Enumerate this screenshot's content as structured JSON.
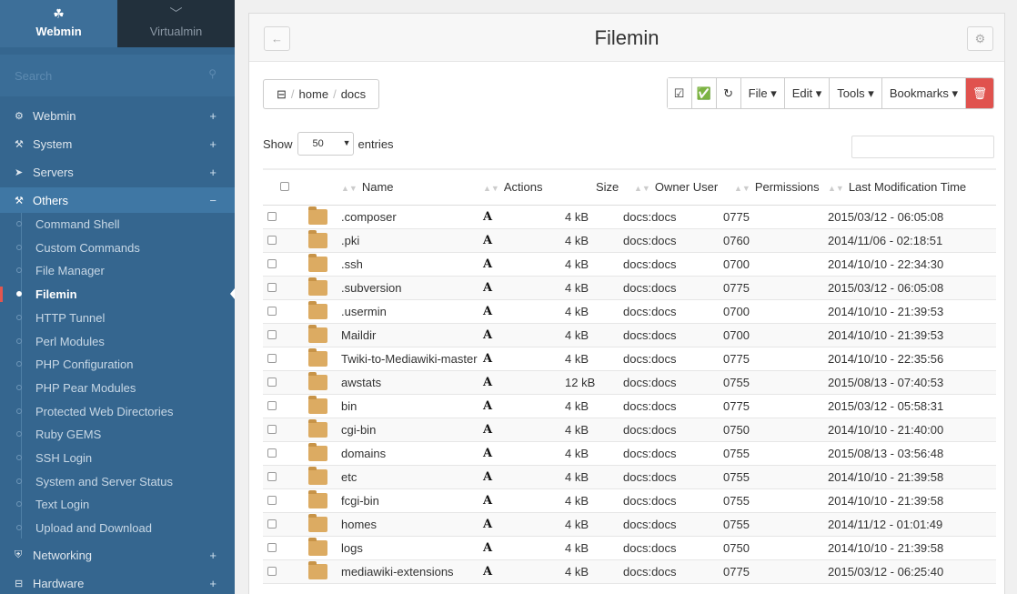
{
  "switcher": {
    "webmin": "Webmin",
    "virtualmin": "Virtualmin",
    "webmin_icon": "webmin-logo-icon",
    "virtualmin_icon": "chevron-down-icon"
  },
  "search": {
    "placeholder": "Search"
  },
  "categories": [
    {
      "label": "Webmin",
      "icon": "gear-icon",
      "state": "+"
    },
    {
      "label": "System",
      "icon": "wrench-icon",
      "state": "+"
    },
    {
      "label": "Servers",
      "icon": "rocket-icon",
      "state": "+"
    },
    {
      "label": "Others",
      "icon": "gavel-icon",
      "state": "−"
    },
    {
      "label": "Networking",
      "icon": "shield-icon",
      "state": "+"
    },
    {
      "label": "Hardware",
      "icon": "hdd-icon",
      "state": "+"
    }
  ],
  "others_items": [
    "Command Shell",
    "Custom Commands",
    "File Manager",
    "Filemin",
    "HTTP Tunnel",
    "Perl Modules",
    "PHP Configuration",
    "PHP Pear Modules",
    "Protected Web Directories",
    "Ruby GEMS",
    "SSH Login",
    "System and Server Status",
    "Text Login",
    "Upload and Download"
  ],
  "active_item": "Filemin",
  "page": {
    "title": "Filemin"
  },
  "breadcrumb": {
    "segments": [
      "home",
      "docs"
    ]
  },
  "toolbar": {
    "file": "File",
    "edit": "Edit",
    "tools": "Tools",
    "bookmarks": "Bookmarks"
  },
  "table": {
    "show_label": "Show",
    "show_value": "50",
    "entries_label": "entries",
    "headers": {
      "name": "Name",
      "actions": "Actions",
      "size": "Size",
      "owner": "Owner User",
      "permissions": "Permissions",
      "mtime": "Last Modification Time"
    },
    "action_glyph": "A",
    "rows": [
      {
        "name": ".composer",
        "size": "4 kB",
        "owner": "docs:docs",
        "perm": "0775",
        "mtime": "2015/03/12 - 06:05:08"
      },
      {
        "name": ".pki",
        "size": "4 kB",
        "owner": "docs:docs",
        "perm": "0760",
        "mtime": "2014/11/06 - 02:18:51"
      },
      {
        "name": ".ssh",
        "size": "4 kB",
        "owner": "docs:docs",
        "perm": "0700",
        "mtime": "2014/10/10 - 22:34:30"
      },
      {
        "name": ".subversion",
        "size": "4 kB",
        "owner": "docs:docs",
        "perm": "0775",
        "mtime": "2015/03/12 - 06:05:08"
      },
      {
        "name": ".usermin",
        "size": "4 kB",
        "owner": "docs:docs",
        "perm": "0700",
        "mtime": "2014/10/10 - 21:39:53"
      },
      {
        "name": "Maildir",
        "size": "4 kB",
        "owner": "docs:docs",
        "perm": "0700",
        "mtime": "2014/10/10 - 21:39:53"
      },
      {
        "name": "Twiki-to-Mediawiki-master",
        "size": "4 kB",
        "owner": "docs:docs",
        "perm": "0775",
        "mtime": "2014/10/10 - 22:35:56"
      },
      {
        "name": "awstats",
        "size": "12 kB",
        "owner": "docs:docs",
        "perm": "0755",
        "mtime": "2015/08/13 - 07:40:53"
      },
      {
        "name": "bin",
        "size": "4 kB",
        "owner": "docs:docs",
        "perm": "0775",
        "mtime": "2015/03/12 - 05:58:31"
      },
      {
        "name": "cgi-bin",
        "size": "4 kB",
        "owner": "docs:docs",
        "perm": "0750",
        "mtime": "2014/10/10 - 21:40:00"
      },
      {
        "name": "domains",
        "size": "4 kB",
        "owner": "docs:docs",
        "perm": "0755",
        "mtime": "2015/08/13 - 03:56:48"
      },
      {
        "name": "etc",
        "size": "4 kB",
        "owner": "docs:docs",
        "perm": "0755",
        "mtime": "2014/10/10 - 21:39:58"
      },
      {
        "name": "fcgi-bin",
        "size": "4 kB",
        "owner": "docs:docs",
        "perm": "0755",
        "mtime": "2014/10/10 - 21:39:58"
      },
      {
        "name": "homes",
        "size": "4 kB",
        "owner": "docs:docs",
        "perm": "0755",
        "mtime": "2014/11/12 - 01:01:49"
      },
      {
        "name": "logs",
        "size": "4 kB",
        "owner": "docs:docs",
        "perm": "0750",
        "mtime": "2014/10/10 - 21:39:58"
      },
      {
        "name": "mediawiki-extensions",
        "size": "4 kB",
        "owner": "docs:docs",
        "perm": "0775",
        "mtime": "2015/03/12 - 06:25:40"
      }
    ]
  },
  "colors": {
    "sidebar": "#35668f",
    "active_marker": "#e2564f",
    "delete_button": "#e0524e",
    "folder": "#dcab62"
  }
}
